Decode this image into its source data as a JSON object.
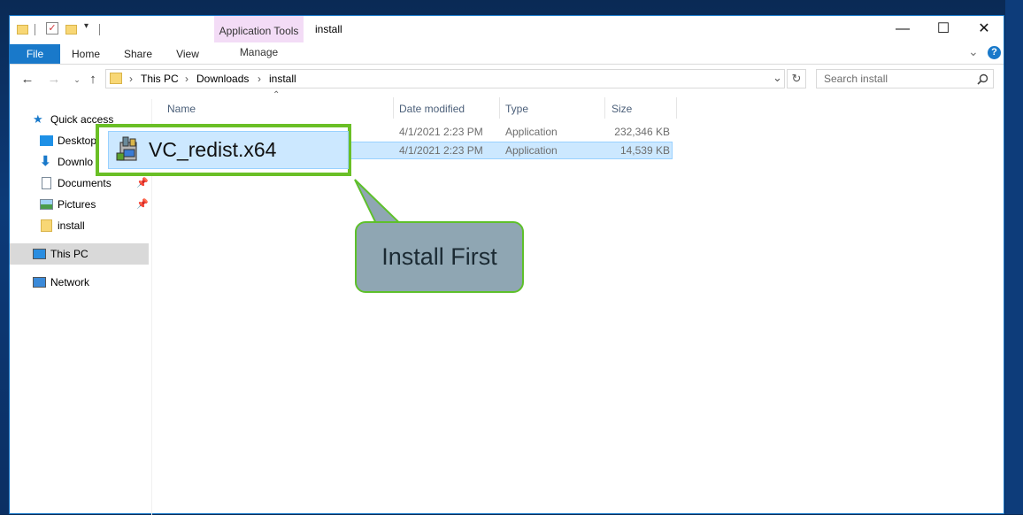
{
  "titlebar": {
    "context_tab": "Application Tools",
    "context_subtab": "Manage",
    "window_title": "install",
    "minimize_icon": "—",
    "maximize_icon": "☐",
    "close_icon": "✕"
  },
  "ribbon": {
    "tabs": [
      "File",
      "Home",
      "Share",
      "View"
    ],
    "expand_icon": "⌄",
    "help_icon": "?"
  },
  "address": {
    "crumbs": [
      "This PC",
      "Downloads",
      "install"
    ],
    "separator": "›",
    "search_placeholder": "Search install"
  },
  "nav": {
    "items": [
      {
        "label": "Quick access",
        "pinned": false
      },
      {
        "label": "Desktop",
        "pinned": false
      },
      {
        "label": "Downlo",
        "pinned": false
      },
      {
        "label": "Documents",
        "pinned": true
      },
      {
        "label": "Pictures",
        "pinned": true
      },
      {
        "label": "install",
        "pinned": false
      },
      {
        "label": "This PC",
        "pinned": false
      },
      {
        "label": "Network",
        "pinned": false
      }
    ]
  },
  "columns": {
    "name": "Name",
    "date": "Date modified",
    "type": "Type",
    "size": "Size"
  },
  "files": [
    {
      "date": "4/1/2021 2:23 PM",
      "type": "Application",
      "size": "232,346 KB"
    },
    {
      "date": "4/1/2021 2:23 PM",
      "type": "Application",
      "size": "14,539 KB"
    }
  ],
  "highlight": {
    "file_name": "VC_redist.x64",
    "callout": "Install First",
    "border_color": "#6abf26"
  }
}
